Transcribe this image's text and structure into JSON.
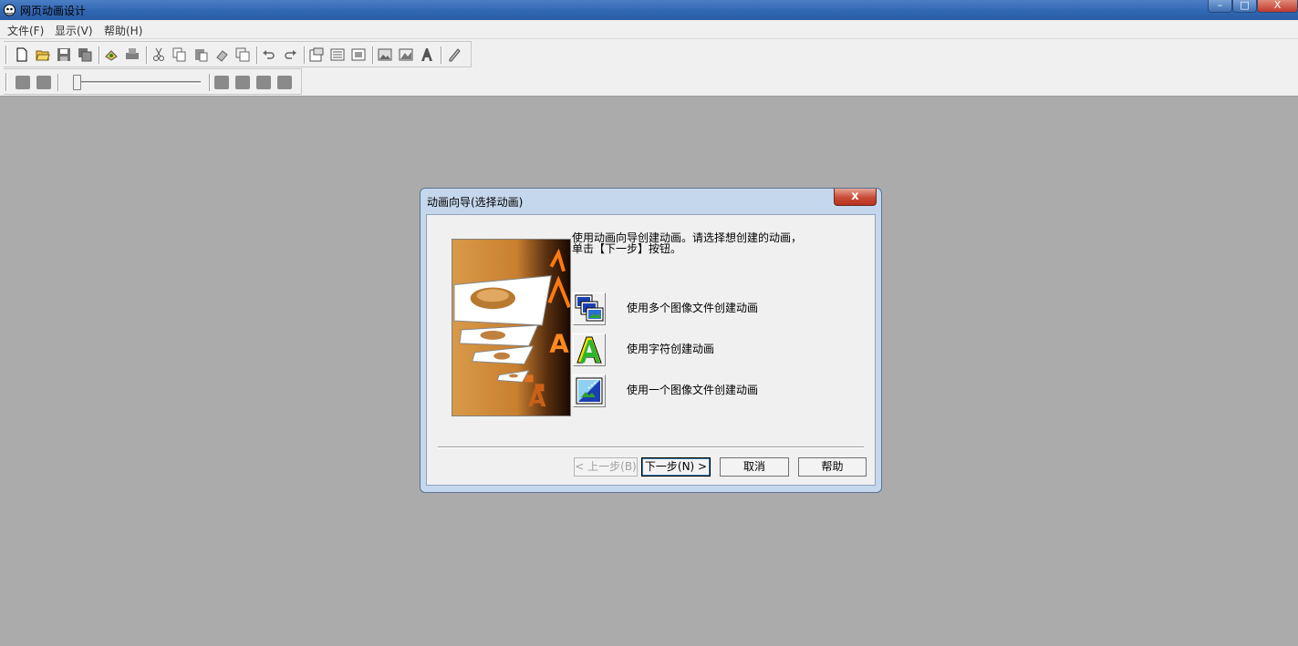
{
  "window": {
    "title": "网页动画设计",
    "controls": {
      "minimize": "–",
      "maximize": "□",
      "close": "X"
    }
  },
  "menubar": {
    "items": [
      "文件(F)",
      "显示(V)",
      "帮助(H)"
    ]
  },
  "toolbar1": {
    "icons": [
      "new-file-icon",
      "open-folder-icon",
      "save-icon",
      "save-all-icon",
      "preview-icon",
      "print-icon",
      "cut-icon",
      "copy-icon",
      "paste-icon",
      "erase-icon",
      "duplicate-icon",
      "undo-icon",
      "redo-icon",
      "properties-icon",
      "list-icon",
      "frame-icon",
      "image-icon",
      "image-effect-icon",
      "text-effect-icon",
      "pen-icon"
    ]
  },
  "toolbar2": {
    "icons": [
      "frame-first-icon",
      "frame-prev-icon",
      "play-icon",
      "stop-icon",
      "frame-next-icon",
      "frame-last-icon"
    ],
    "slider_value": 0
  },
  "dialog": {
    "title": "动画向导(选择动画)",
    "close": "x",
    "intro_line1": "使用动画向导创建动画。请选择想创建的动画，",
    "intro_line2": "单击【下一步】按钮。",
    "options": [
      {
        "label": "使用多个图像文件创建动画",
        "icon": "multi-image-icon"
      },
      {
        "label": "使用字符创建动画",
        "icon": "text-animation-icon"
      },
      {
        "label": "使用一个图像文件创建动画",
        "icon": "single-image-icon"
      }
    ],
    "buttons": {
      "back": "< 上一步(B)",
      "next": "下一步(N) >",
      "cancel": "取消",
      "help": "帮助"
    }
  }
}
